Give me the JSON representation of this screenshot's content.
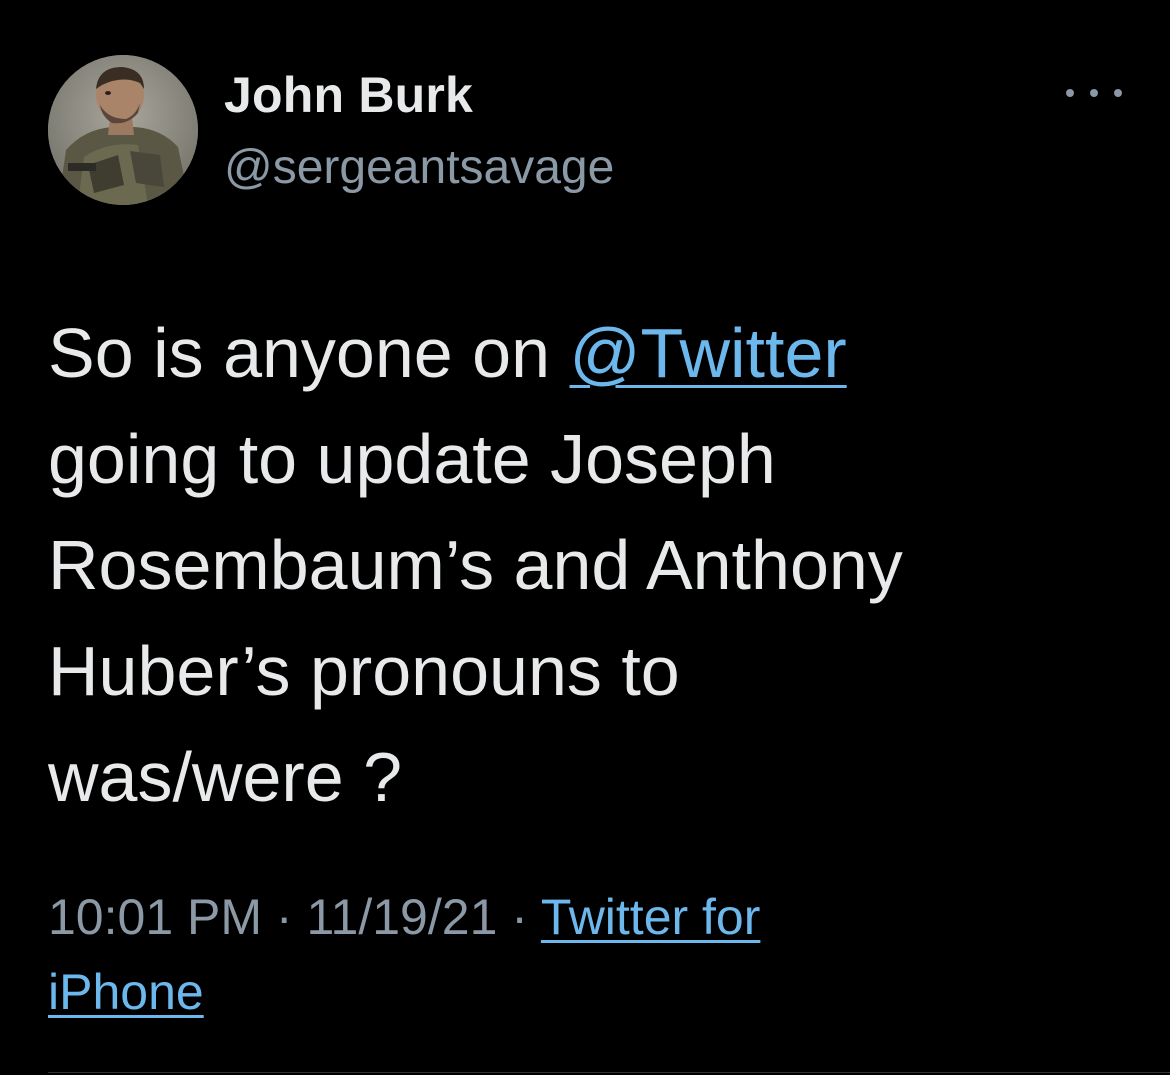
{
  "author": {
    "display_name": "John Burk",
    "handle": "@sergeantsavage",
    "avatar_icon": "profile-photo"
  },
  "more_icon": "more-horizontal-icon",
  "tweet": {
    "line1_prefix": "So is anyone on ",
    "mention": "@Twitter",
    "line2": "going to update Joseph",
    "line3": "Rosembaum’s and Anthony",
    "line4": "Huber’s pronouns to",
    "line5": "was/were ?"
  },
  "meta": {
    "time": "10:01 PM",
    "separator1": " · ",
    "date": "11/19/21",
    "separator2": " · ",
    "source_part1": "Twitter for",
    "source_part2": "iPhone"
  },
  "colors": {
    "background": "#000000",
    "text": "#e7e9ea",
    "secondary": "#8b98a5",
    "link": "#6cb7ec"
  }
}
